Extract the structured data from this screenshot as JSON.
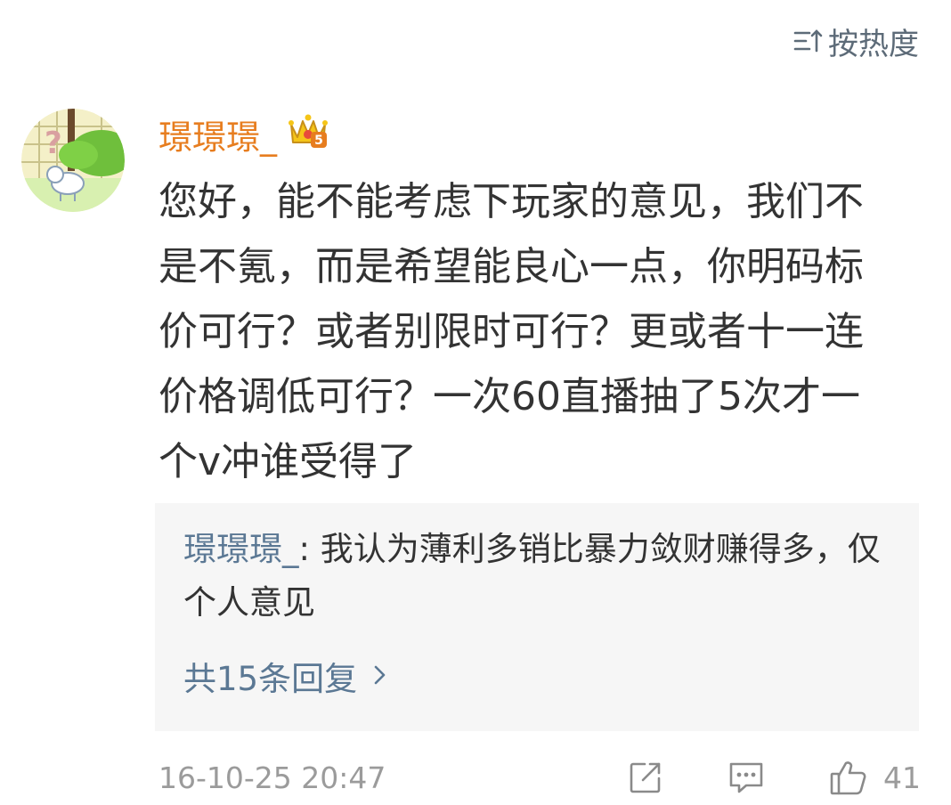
{
  "sort": {
    "label": "按热度",
    "icon": "sort-lines-icon"
  },
  "comment": {
    "username": "璟璟璟_",
    "badge_icon": "crown-level-icon",
    "badge_level": "5",
    "text": "您好，能不能考虑下玩家的意见，我们不是不氪，而是希望能良心一点，你明码标价可行？或者别限时可行？更或者十一连价格调低可行？一次60直播抽了5次才一个v冲谁受得了",
    "timestamp": "16-10-25 20:47",
    "like_count": "41"
  },
  "reply_preview": {
    "user": "璟璟璟_",
    "separator": ": ",
    "text": "我认为薄利多销比暴力敛财赚得多，仅个人意见",
    "more_label": "共15条回复"
  },
  "icons": {
    "share": "share-icon",
    "reply": "comment-icon",
    "like": "thumbs-up-icon",
    "more": "chevron-right-icon"
  },
  "colors": {
    "username": "#e77d1f",
    "link": "#5b7894",
    "meta": "#9b9b9b",
    "reply_bg": "#f6f6f6"
  }
}
